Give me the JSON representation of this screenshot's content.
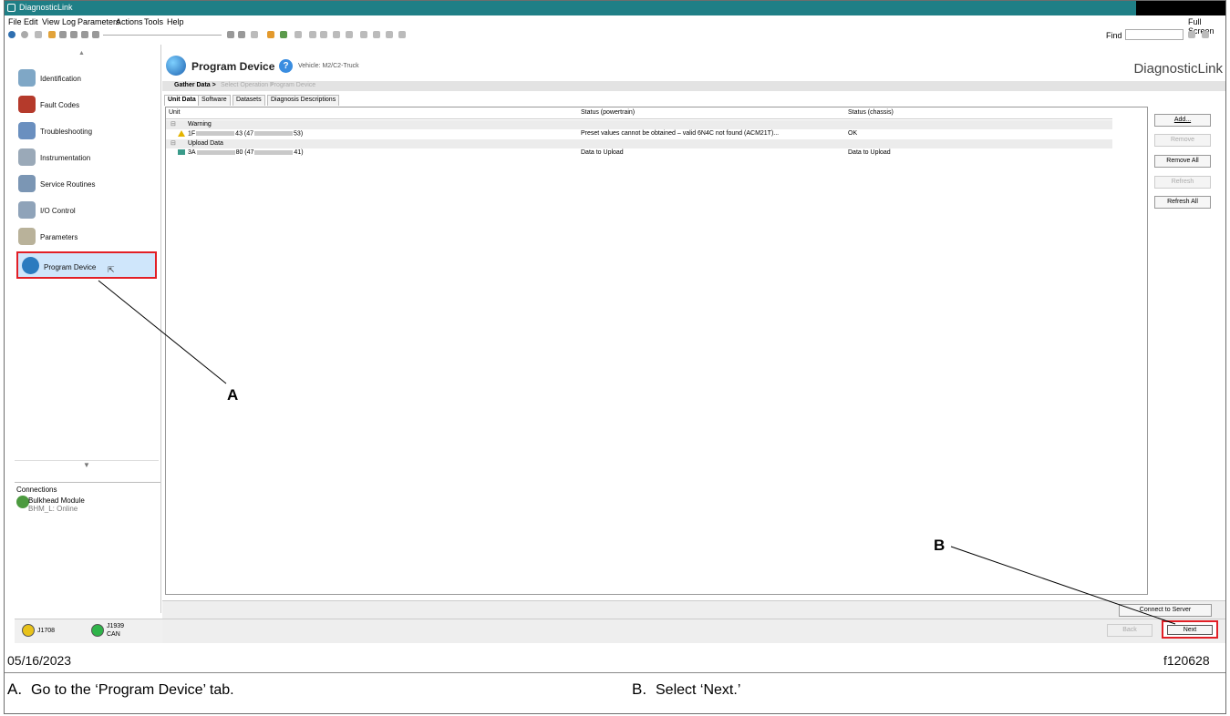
{
  "window": {
    "title": "DiagnosticLink"
  },
  "menu": {
    "items": [
      "File",
      "Edit",
      "View",
      "Log",
      "Parameters",
      "Actions",
      "Tools",
      "Help"
    ],
    "right": "Full Screen"
  },
  "toolbar": {
    "find_label": "Find"
  },
  "sidebar": {
    "items": [
      {
        "label": "Identification",
        "icon": "id-card-icon",
        "color": "#7fa7c6"
      },
      {
        "label": "Fault Codes",
        "icon": "fault-codes-icon",
        "color": "#b53a2b"
      },
      {
        "label": "Troubleshooting",
        "icon": "stethoscope-icon",
        "color": "#6a8fbf"
      },
      {
        "label": "Instrumentation",
        "icon": "gauge-chart-icon",
        "color": "#9aa9b8"
      },
      {
        "label": "Service Routines",
        "icon": "gears-icon",
        "color": "#7b96b4"
      },
      {
        "label": "I/O Control",
        "icon": "io-control-icon",
        "color": "#8fa3b9"
      },
      {
        "label": "Parameters",
        "icon": "pencil-icon",
        "color": "#b9b29a"
      },
      {
        "label": "Program Device",
        "icon": "program-device-icon",
        "color": "#2b7bbf",
        "selected": true
      }
    ]
  },
  "connections": {
    "header": "Connections",
    "module_name": "Bulkhead Module",
    "module_status": "BHM_L: Online"
  },
  "status": {
    "j1708": "J1708",
    "j1939_line1": "J1939",
    "j1939_line2": "CAN",
    "j1708_color": "#e8c21a",
    "j1939_color": "#2fb44a"
  },
  "main": {
    "title": "Program Device",
    "vehicle": "Vehicle: M2/C2-Truck",
    "brand": "DiagnosticLink",
    "breadcrumbs": [
      "Gather Data >",
      "Select Operation >",
      "Program Device"
    ],
    "tabs": [
      "Unit Data",
      "Software",
      "Datasets",
      "Diagnosis Descriptions"
    ],
    "columns": [
      "Unit",
      "Status (powertrain)",
      "Status (chassis)"
    ],
    "groups": [
      {
        "name": "Warning",
        "row": {
          "unit_prefix": "1F",
          "unit_mid": "43 (47",
          "unit_suffix": "53)",
          "powertrain": "Preset values cannot be obtained – valid 6N4C not found (ACM21T)...",
          "chassis": "OK"
        }
      },
      {
        "name": "Upload Data",
        "row": {
          "unit_prefix": "3A",
          "unit_mid": "80 (47",
          "unit_suffix": "41)",
          "powertrain": "Data to Upload",
          "chassis": "Data to Upload"
        }
      }
    ],
    "buttons": {
      "add": "Add...",
      "remove": "Remove",
      "remove_all": "Remove All",
      "refresh": "Refresh",
      "refresh_all": "Refresh All"
    },
    "connect_server": "Connect to Server",
    "back": "Back",
    "next": "Next"
  },
  "annotations": {
    "label_a": "A",
    "label_b": "B",
    "date": "05/16/2023",
    "figure_id": "f120628",
    "caption_a_letter": "A.",
    "caption_a_text": "Go to the ‘Program Device’ tab.",
    "caption_b_letter": "B.",
    "caption_b_text": "Select ‘Next.’",
    "highlight_color": "#e21f26"
  }
}
